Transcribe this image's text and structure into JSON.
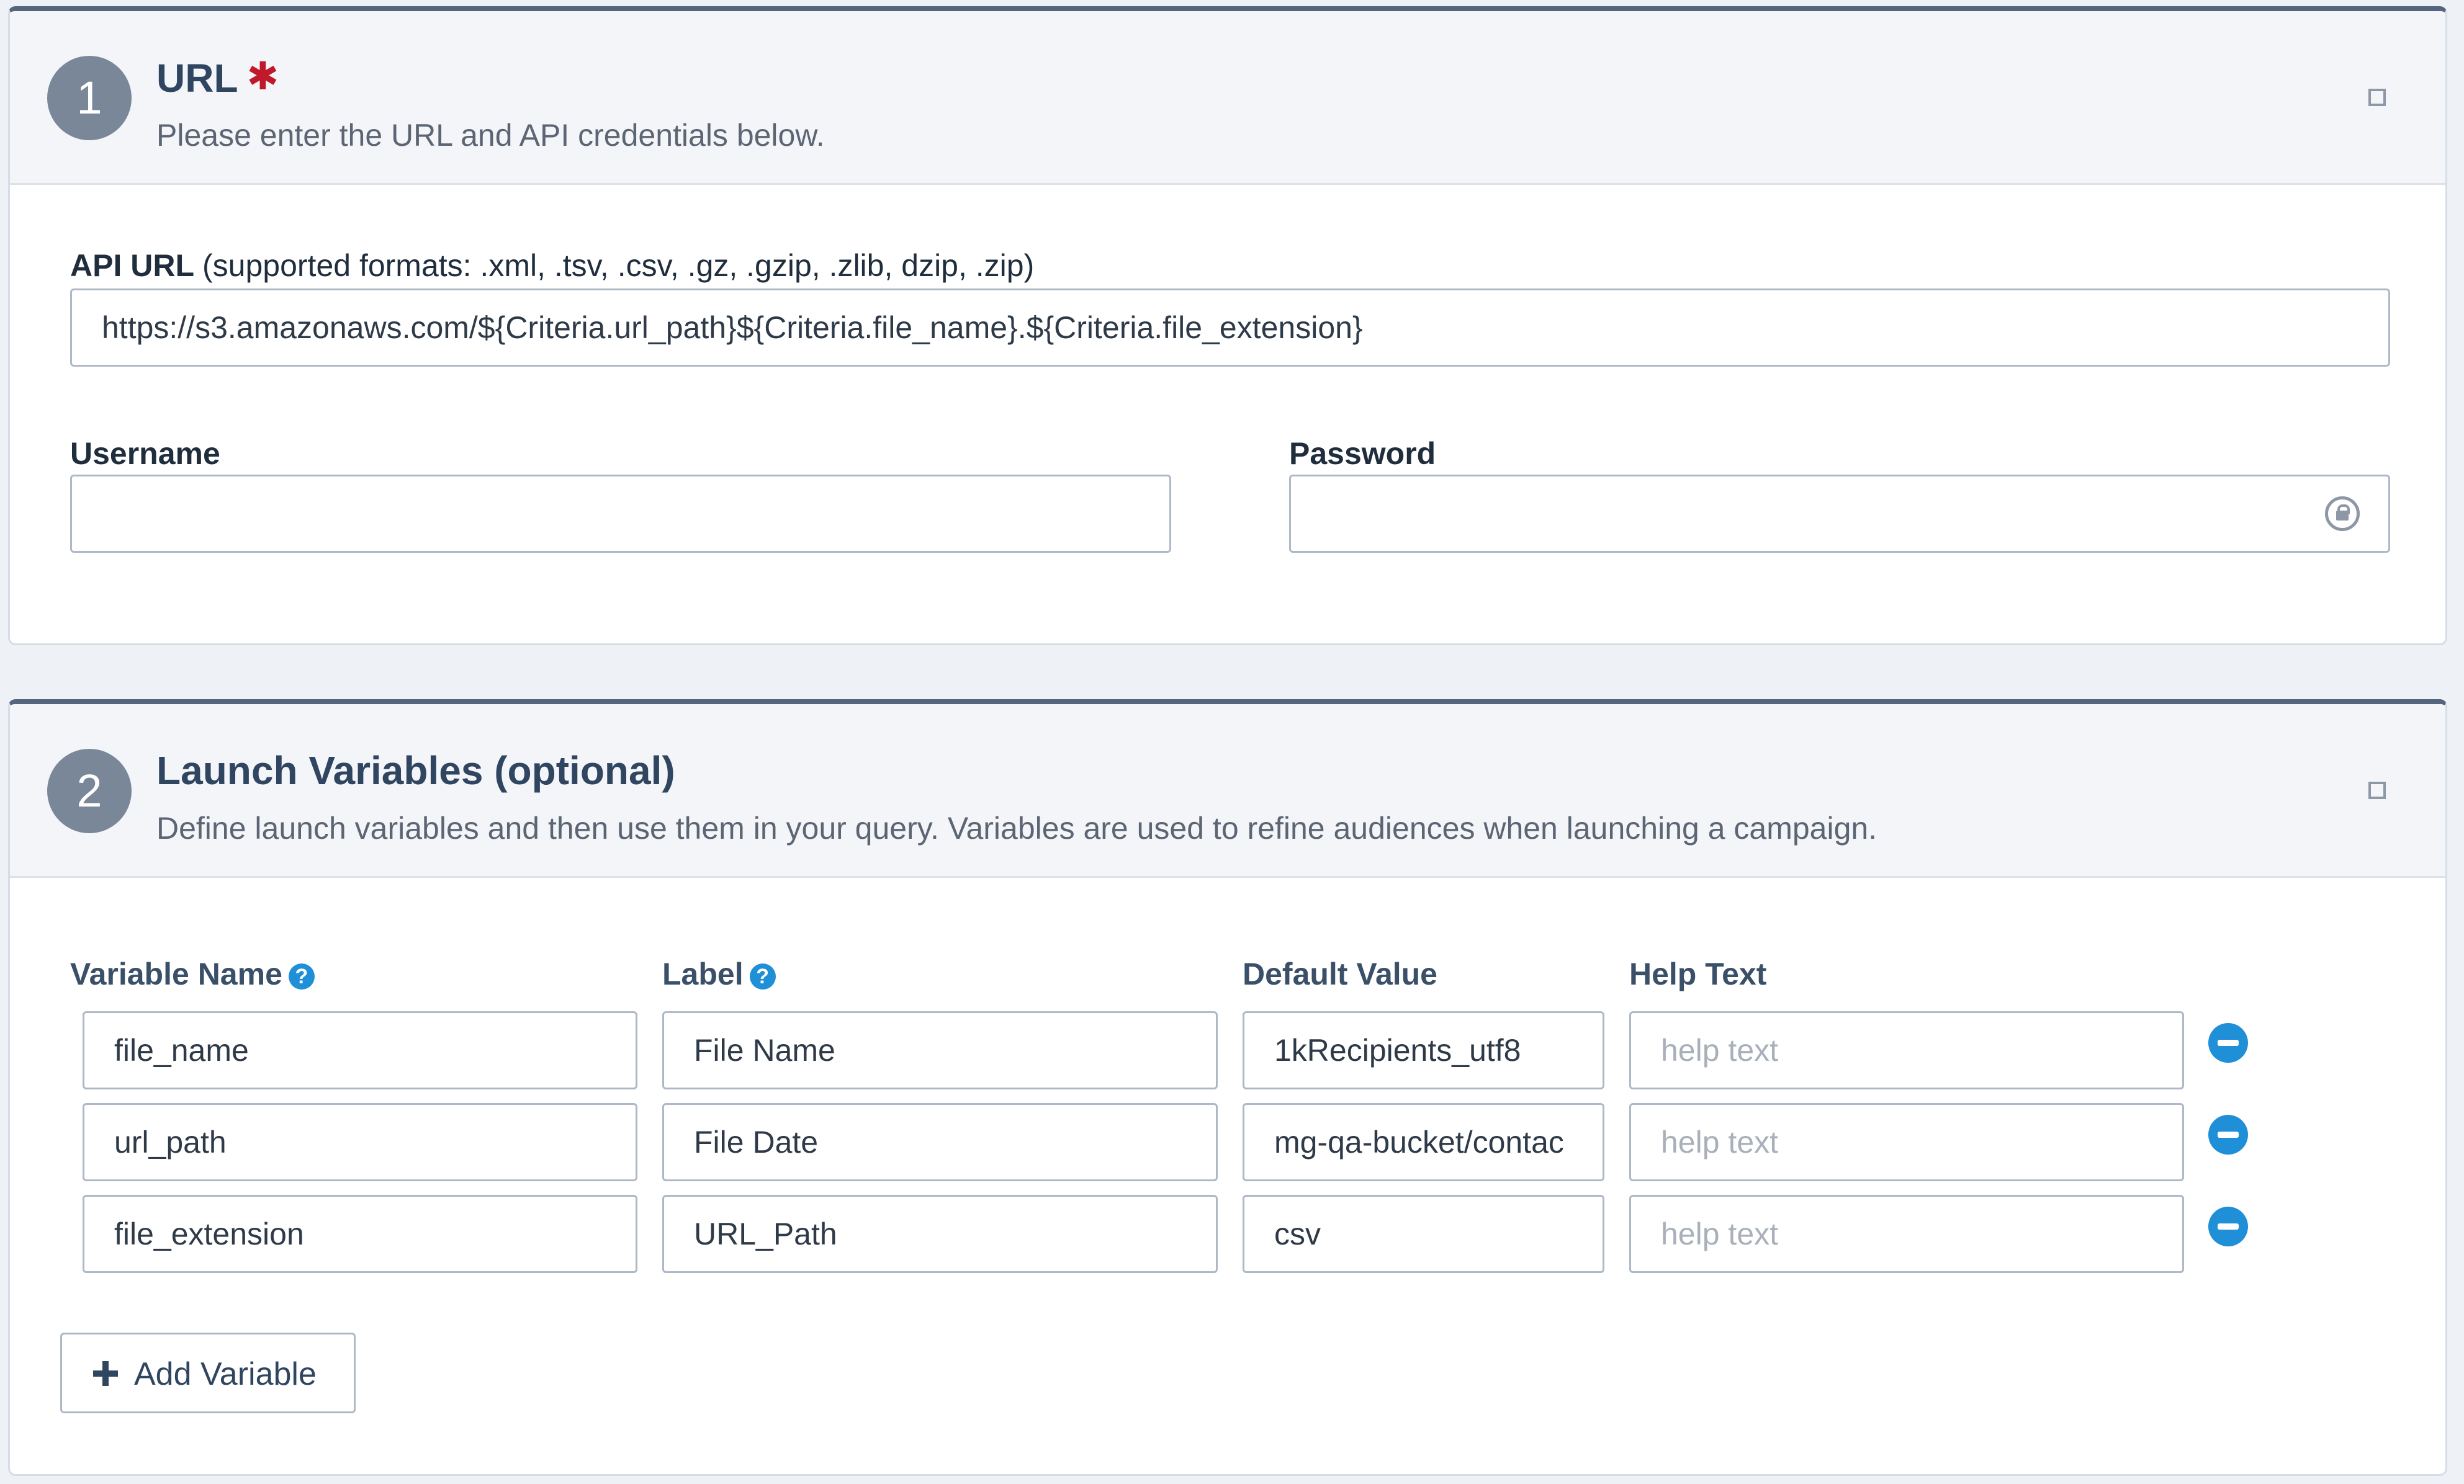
{
  "url_section": {
    "step": "1",
    "title": "URL",
    "required_mark": "✱",
    "description": "Please enter the URL and API credentials below.",
    "api_url": {
      "label": "API URL",
      "note": "(supported formats: .xml, .tsv, .csv, .gz, .gzip, .zlib, dzip, .zip)",
      "value": "https://s3.amazonaws.com/${Criteria.url_path}${Criteria.file_name}.${Criteria.file_extension}"
    },
    "username": {
      "label": "Username",
      "value": ""
    },
    "password": {
      "label": "Password",
      "value": ""
    }
  },
  "variables_section": {
    "step": "2",
    "title": "Launch Variables (optional)",
    "description": "Define launch variables and then use them in your query. Variables are used to refine audiences when launching a campaign.",
    "columns": {
      "name": "Variable Name",
      "label": "Label",
      "default": "Default Value",
      "help": "Help Text"
    },
    "help_placeholder": "help text",
    "rows": [
      {
        "name": "file_name",
        "label": "File Name",
        "default": "1kRecipients_utf8",
        "help": ""
      },
      {
        "name": "url_path",
        "label": "File Date",
        "default": "mg-qa-bucket/contac",
        "help": ""
      },
      {
        "name": "file_extension",
        "label": "URL_Path",
        "default": "csv",
        "help": ""
      }
    ],
    "add_button": "Add Variable"
  },
  "icons": {
    "help": "question-circle-icon",
    "remove": "minus-circle-icon",
    "add": "plus-icon",
    "password": "password-lock-icon",
    "collapse": "collapse-square-icon"
  },
  "colors": {
    "accent": "#1f8fd8",
    "required": "#c0192b",
    "panel_top_border": "#54657d",
    "badge": "#7a8799"
  }
}
